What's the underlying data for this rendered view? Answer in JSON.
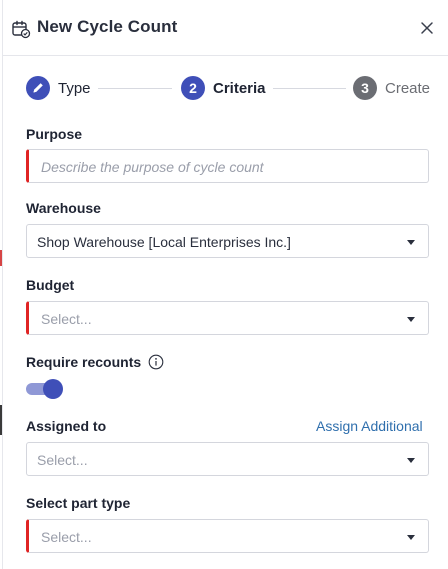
{
  "dialog": {
    "title": "New Cycle Count",
    "close_icon": "close-icon",
    "header_icon": "calendar-check-icon"
  },
  "steps": [
    {
      "number": "",
      "label": "Type",
      "state": "completed",
      "icon": "pencil-icon"
    },
    {
      "number": "2",
      "label": "Criteria",
      "state": "active"
    },
    {
      "number": "3",
      "label": "Create",
      "state": "upcoming"
    }
  ],
  "form": {
    "purpose": {
      "label": "Purpose",
      "placeholder": "Describe the purpose of cycle count",
      "value": ""
    },
    "warehouse": {
      "label": "Warehouse",
      "value": "Shop Warehouse [Local Enterprises Inc.]"
    },
    "budget": {
      "label": "Budget",
      "placeholder": "Select..."
    },
    "require_recounts": {
      "label": "Require recounts",
      "info_icon": "info-icon",
      "enabled": true
    },
    "assigned_to": {
      "label": "Assigned to",
      "placeholder": "Select...",
      "link": "Assign Additional"
    },
    "part_type": {
      "label": "Select part type",
      "placeholder": "Select..."
    }
  },
  "colors": {
    "primary": "#3f4fb8",
    "required": "#e02424",
    "link": "#2f6fad",
    "step_inactive": "#6b6d73"
  }
}
